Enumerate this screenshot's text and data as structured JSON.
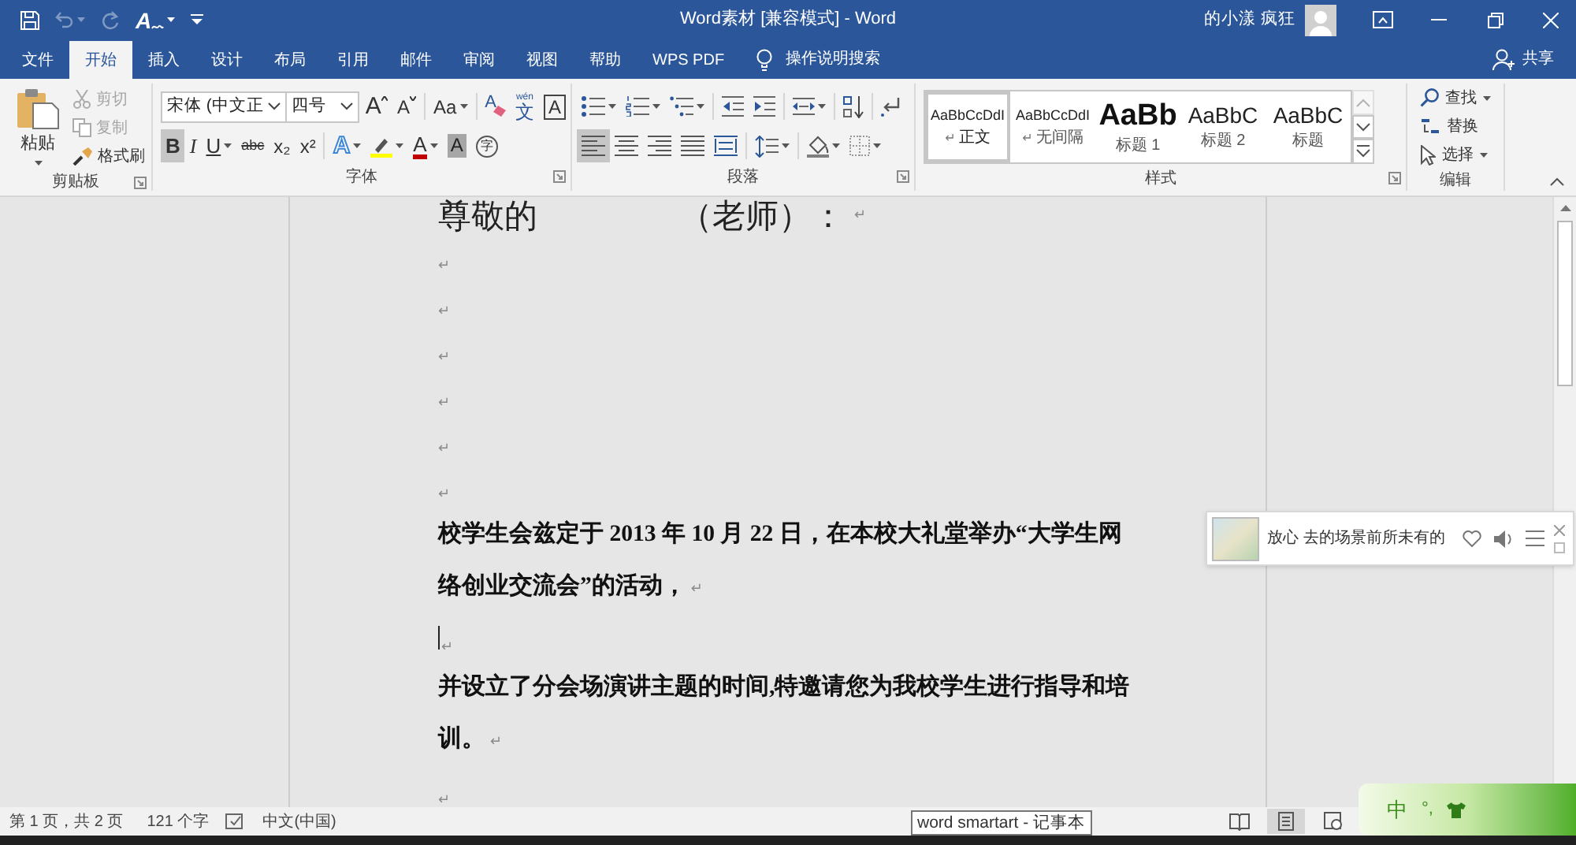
{
  "window": {
    "title": "Word素材 [兼容模式] - Word",
    "user": "的小漾 疯狂"
  },
  "quick_access": [
    {
      "kind": "save",
      "disabled": false,
      "dropdown": false
    },
    {
      "kind": "undo",
      "disabled": true,
      "dropdown": true
    },
    {
      "kind": "redo",
      "disabled": true,
      "dropdown": false
    },
    {
      "kind": "handwriting",
      "glyph": "A",
      "disabled": false,
      "dropdown": true
    },
    {
      "kind": "customize",
      "disabled": false,
      "dropdown": false
    }
  ],
  "tabs": [
    {
      "label": "文件",
      "selected": false
    },
    {
      "label": "开始",
      "selected": true
    },
    {
      "label": "插入",
      "selected": false
    },
    {
      "label": "设计",
      "selected": false
    },
    {
      "label": "布局",
      "selected": false
    },
    {
      "label": "引用",
      "selected": false
    },
    {
      "label": "邮件",
      "selected": false
    },
    {
      "label": "审阅",
      "selected": false
    },
    {
      "label": "视图",
      "selected": false
    },
    {
      "label": "帮助",
      "selected": false
    },
    {
      "label": "WPS PDF",
      "selected": false
    }
  ],
  "tell_me": "操作说明搜索",
  "share": "共享",
  "ribbon": {
    "clipboard": {
      "label": "剪贴板",
      "launcher": true,
      "paste": {
        "label": "粘贴",
        "dropdown": true
      },
      "items": [
        {
          "kind": "cut",
          "label": "剪切",
          "disabled": true
        },
        {
          "kind": "copy",
          "label": "复制",
          "disabled": true
        },
        {
          "kind": "format_painter",
          "label": "格式刷",
          "disabled": false
        }
      ]
    },
    "font": {
      "label": "字体",
      "launcher": true,
      "font_name": "宋体 (中文正",
      "font_size": "四号",
      "row_1": [
        [
          {
            "kind": "grow_font",
            "glyph": "A",
            "dropdown": false,
            "selected": false
          },
          {
            "kind": "shrink_font",
            "glyph": "A",
            "dropdown": false,
            "selected": false
          }
        ],
        [
          {
            "kind": "change_case",
            "glyph": "Aa",
            "dropdown": true,
            "selected": false
          }
        ],
        [
          {
            "kind": "clear_formatting",
            "glyph": "A",
            "dropdown": false,
            "selected": false
          },
          {
            "kind": "phonetic_guide",
            "glyph": "文",
            "ruby": "wén",
            "dropdown": false,
            "selected": false
          },
          {
            "kind": "char_border",
            "glyph": "A",
            "dropdown": false,
            "selected": false
          }
        ]
      ],
      "row_2": [
        [
          {
            "kind": "bold",
            "glyph": "B",
            "dropdown": false,
            "selected": true
          },
          {
            "kind": "italic",
            "glyph": "I",
            "dropdown": false,
            "selected": false
          },
          {
            "kind": "underline",
            "glyph": "U",
            "dropdown": true,
            "selected": false
          },
          {
            "kind": "strikethrough",
            "glyph": "abc",
            "dropdown": false,
            "selected": false
          },
          {
            "kind": "subscript",
            "glyph": "x₂",
            "dropdown": false,
            "selected": false
          },
          {
            "kind": "superscript",
            "glyph": "x²",
            "dropdown": false,
            "selected": false
          }
        ],
        [
          {
            "kind": "text_effects",
            "glyph": "A",
            "dropdown": true,
            "selected": false
          },
          {
            "kind": "highlight",
            "dropdown": true,
            "selected": false
          },
          {
            "kind": "font_color",
            "glyph": "A",
            "dropdown": true,
            "selected": false
          },
          {
            "kind": "char_shading",
            "glyph": "A",
            "dropdown": false,
            "selected": false
          },
          {
            "kind": "enclosed",
            "glyph": "字",
            "dropdown": false,
            "selected": false
          }
        ]
      ]
    },
    "paragraph": {
      "label": "段落",
      "launcher": true,
      "row_1": [
        [
          {
            "kind": "bullets",
            "dropdown": true,
            "selected": false
          },
          {
            "kind": "numbering",
            "dropdown": true,
            "selected": false
          },
          {
            "kind": "multilevel",
            "dropdown": true,
            "selected": false
          }
        ],
        [
          {
            "kind": "decrease_indent",
            "dropdown": false,
            "selected": false
          },
          {
            "kind": "increase_indent",
            "dropdown": false,
            "selected": false
          }
        ],
        [
          {
            "kind": "asian_layout",
            "dropdown": true,
            "selected": false
          }
        ],
        [
          {
            "kind": "sort",
            "dropdown": false,
            "selected": false
          }
        ],
        [
          {
            "kind": "show_marks",
            "dropdown": false,
            "selected": false
          }
        ]
      ],
      "row_2": [
        [
          {
            "kind": "align_left",
            "dropdown": false,
            "selected": true
          },
          {
            "kind": "align_center",
            "dropdown": false,
            "selected": false
          },
          {
            "kind": "align_right",
            "dropdown": false,
            "selected": false
          },
          {
            "kind": "justify",
            "dropdown": false,
            "selected": false
          },
          {
            "kind": "distributed",
            "dropdown": false,
            "selected": false
          }
        ],
        [
          {
            "kind": "line_spacing",
            "dropdown": true,
            "selected": false
          }
        ],
        [
          {
            "kind": "shading",
            "dropdown": true,
            "selected": false
          },
          {
            "kind": "borders",
            "dropdown": true,
            "selected": false
          }
        ]
      ]
    },
    "styles": {
      "label": "样式",
      "launcher": true,
      "gallery": [
        {
          "kind": "normal",
          "sample": "AaBbCcDdI",
          "mark": "↵",
          "name": "正文",
          "selected": true
        },
        {
          "kind": "normal",
          "sample": "AaBbCcDdI",
          "mark": "↵",
          "name": "无间隔",
          "selected": false
        },
        {
          "kind": "heading1",
          "sample": "AaBb",
          "name": "标题 1",
          "selected": false
        },
        {
          "kind": "heading2",
          "sample": "AaBbC",
          "name": "标题 2",
          "selected": false
        },
        {
          "kind": "title",
          "sample": "AaBbC",
          "name": "标题",
          "selected": false
        }
      ],
      "scroll": [
        {
          "kind": "up",
          "disabled": true
        },
        {
          "kind": "down",
          "disabled": false
        },
        {
          "kind": "more",
          "disabled": false
        }
      ]
    },
    "editing": {
      "label": "编辑",
      "launcher": false,
      "items": [
        {
          "kind": "find",
          "label": "查找",
          "dropdown": true
        },
        {
          "kind": "replace",
          "label": "替换",
          "dropdown": false
        },
        {
          "kind": "select",
          "label": "选择",
          "dropdown": true
        }
      ]
    }
  },
  "document": {
    "paragraphs": [
      {
        "kind": "salutation",
        "parts": [
          "尊敬的",
          "（老师）："
        ],
        "mark": "↵",
        "cursor": false
      },
      {
        "kind": "empty",
        "mark": "↵",
        "cursor": false
      },
      {
        "kind": "empty",
        "mark": "↵",
        "cursor": false
      },
      {
        "kind": "empty",
        "mark": "↵",
        "cursor": false
      },
      {
        "kind": "empty",
        "mark": "↵",
        "cursor": false
      },
      {
        "kind": "empty",
        "mark": "↵",
        "cursor": false
      },
      {
        "kind": "empty",
        "mark": "↵",
        "cursor": false
      },
      {
        "kind": "body",
        "text": "校学生会兹定于 2013 年 10 月 22 日，在本校大礼堂举办“大学生网络创业交流会”的活动，",
        "mark": "↵",
        "cursor": false
      },
      {
        "kind": "empty",
        "mark": "↵",
        "cursor": true
      },
      {
        "kind": "body",
        "text": "并设立了分会场演讲主题的时间,特邀请您为我校学生进行指导和培训。",
        "mark": "↵",
        "cursor": false
      },
      {
        "kind": "empty",
        "mark": "↵",
        "cursor": false
      }
    ]
  },
  "music_widget": {
    "text": "放心 去的场景前所未有的"
  },
  "status_bar": {
    "page": "第 1 页，共 2 页",
    "words": "121 个字",
    "language": "中文(中国)",
    "views": [
      {
        "kind": "read",
        "selected": false
      },
      {
        "kind": "print",
        "selected": true
      },
      {
        "kind": "web",
        "selected": false
      }
    ]
  },
  "tooltip": "word smartart - 记事本",
  "ime_toolbar": {
    "mode": "中",
    "punctuation": "°,"
  }
}
